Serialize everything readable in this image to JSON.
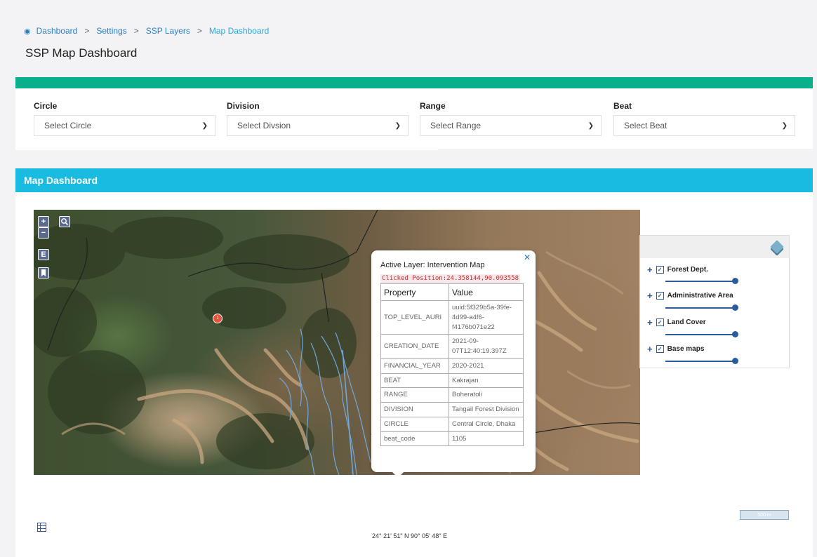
{
  "breadcrumb": {
    "items": [
      "Dashboard",
      "Settings",
      "SSP Layers",
      "Map Dashboard"
    ],
    "separator": ">"
  },
  "page_title": "SSP Map Dashboard",
  "filters": [
    {
      "label": "Circle",
      "placeholder": "Select Circle"
    },
    {
      "label": "Division",
      "placeholder": "Select Divsion"
    },
    {
      "label": "Range",
      "placeholder": "Select Range"
    },
    {
      "label": "Beat",
      "placeholder": "Select Beat"
    }
  ],
  "map_panel": {
    "header": "Map Dashboard",
    "controls": {
      "zoom_in": "+",
      "zoom_out": "−",
      "extent": "E"
    },
    "marker_label": "1",
    "popup": {
      "title": "Active Layer: Intervention Map",
      "clicked_position": "Clicked Position:24.358144,90.093558",
      "col_property": "Property",
      "col_value": "Value",
      "rows": [
        {
          "property": "TOP_LEVEL_AURI",
          "value": "uuid:5f329b5a-39fe-4d99-a4f6-f4176b071e22"
        },
        {
          "property": "CREATION_DATE",
          "value": "2021-09-07T12:40:19.397Z"
        },
        {
          "property": "FINANCIAL_YEAR",
          "value": "2020-2021"
        },
        {
          "property": "BEAT",
          "value": "Kakrajan"
        },
        {
          "property": "RANGE",
          "value": "Boheratoli"
        },
        {
          "property": "DIVISION",
          "value": "Tangail Forest Division"
        },
        {
          "property": "CIRCLE",
          "value": "Central Circle, Dhaka"
        },
        {
          "property": "beat_code",
          "value": "1105"
        }
      ]
    },
    "layers": [
      {
        "name": "Forest Dept.",
        "checked": true,
        "opacity": 1.0
      },
      {
        "name": "Administrative Area",
        "checked": true,
        "opacity": 1.0
      },
      {
        "name": "Land Cover",
        "checked": true,
        "opacity": 1.0
      },
      {
        "name": "Base maps",
        "checked": true,
        "opacity": 1.0
      }
    ],
    "scale_label": "500 m",
    "mouse_position": "24° 21' 51\" N 90° 05' 48\" E"
  },
  "colors": {
    "filter_bar": "#0ab08b",
    "map_header": "#19bbe1",
    "link": "#2a7fc1",
    "marker": "#e8523a",
    "layer_accent": "#2a5c9c",
    "boundary_blue": "#6fa8dc"
  },
  "icons": {
    "home": "dashboard-icon",
    "zoom_in": "plus-icon",
    "zoom_out": "minus-icon",
    "search": "search-icon",
    "bookmark": "bookmark-icon",
    "close": "close-icon",
    "layers": "layers-icon",
    "legend": "list-icon"
  }
}
